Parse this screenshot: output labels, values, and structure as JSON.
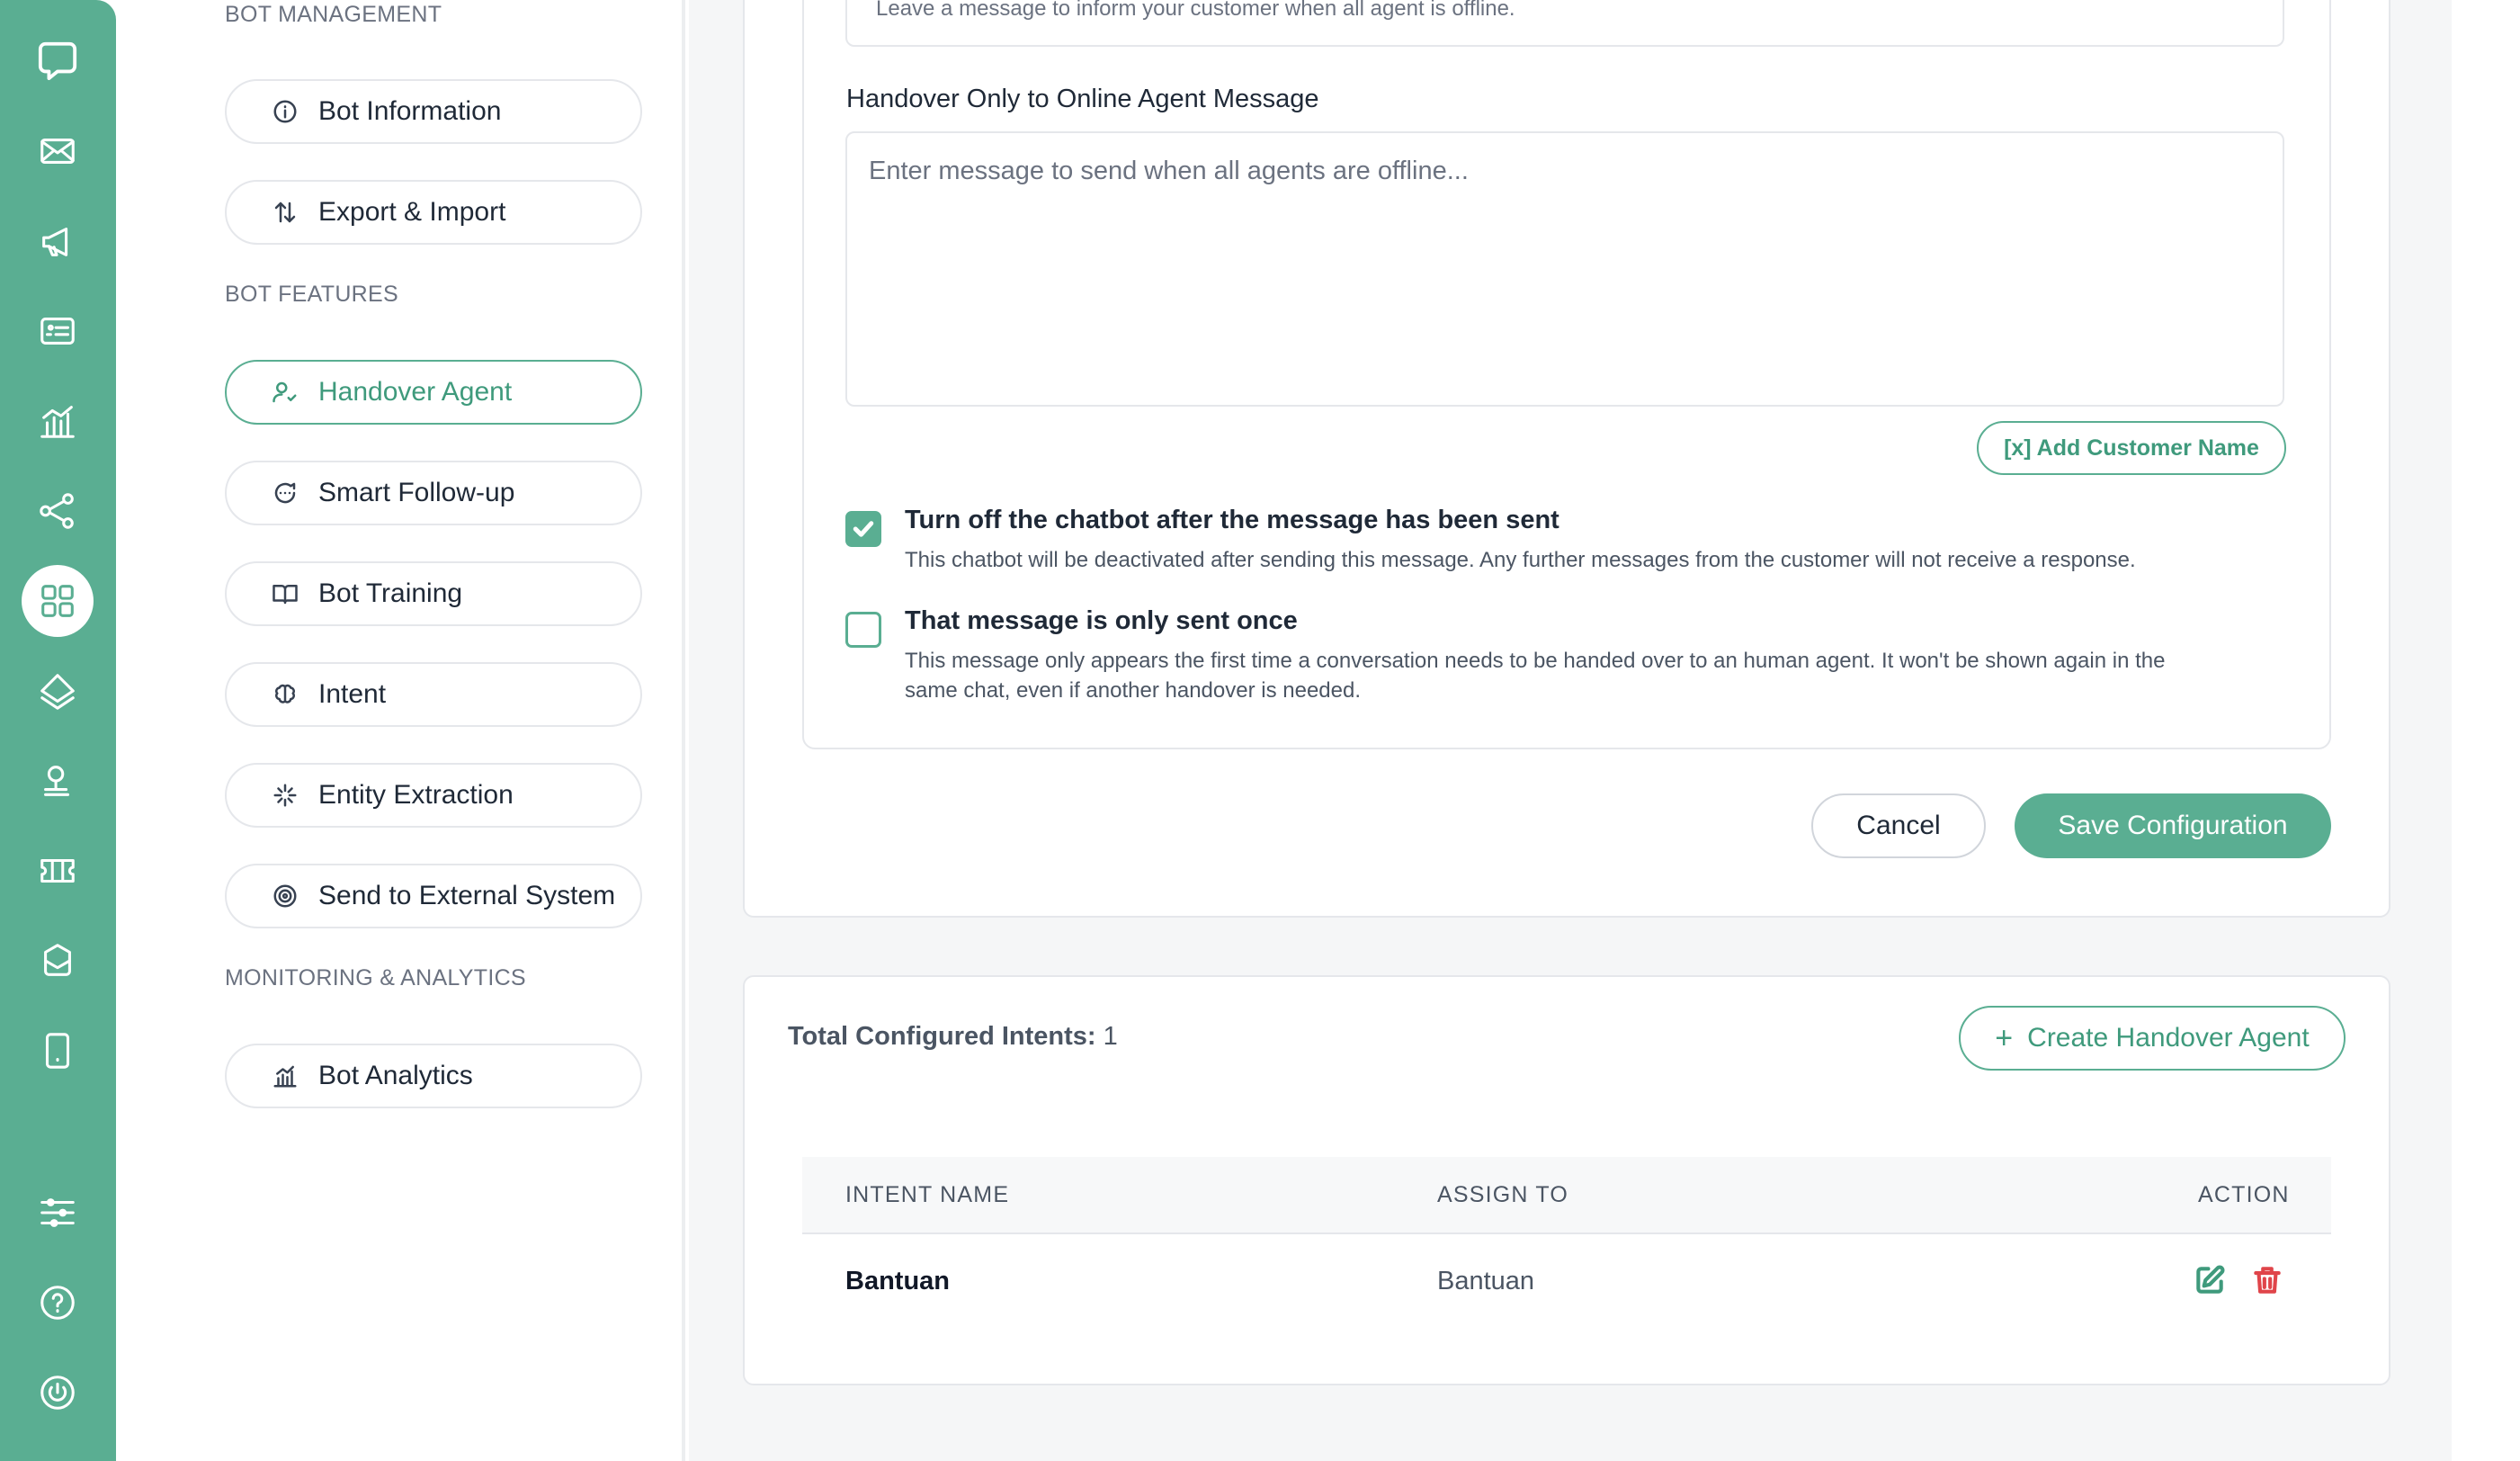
{
  "sidebar": {
    "sections": {
      "bot_management": "BOT MANAGEMENT",
      "bot_features": "BOT FEATURES",
      "monitoring": "MONITORING & ANALYTICS"
    },
    "items": [
      {
        "label": "Bot Information",
        "icon": "info-icon"
      },
      {
        "label": "Export & Import",
        "icon": "arrows-up-down-icon"
      },
      {
        "label": "Handover Agent",
        "icon": "user-check-icon",
        "active": true
      },
      {
        "label": "Smart Follow-up",
        "icon": "chat-bubble-icon"
      },
      {
        "label": "Bot Training",
        "icon": "book-open-icon"
      },
      {
        "label": "Intent",
        "icon": "brain-icon"
      },
      {
        "label": "Entity Extraction",
        "icon": "sparkle-icon"
      },
      {
        "label": "Send to External System",
        "icon": "target-icon"
      },
      {
        "label": "Bot Analytics",
        "icon": "bar-chart-icon"
      }
    ]
  },
  "form": {
    "offline_placeholder": "Leave a message to inform your customer when all agent is offline.",
    "handover_label": "Handover Only to Online Agent Message",
    "handover_placeholder": "Enter message to send when all agents are offline...",
    "add_customer_name": "[x] Add Customer Name",
    "options": [
      {
        "title": "Turn off the chatbot after the message has been sent",
        "desc": "This chatbot will be deactivated after sending this message. Any further messages from the customer will not receive a response.",
        "checked": true
      },
      {
        "title": "That message is only sent once",
        "desc_line1": "This message only appears the first time a conversation needs to be handed over to an human agent. It won't be shown again in the",
        "desc_line2": "same chat, even if another handover is needed.",
        "checked": false
      }
    ],
    "cancel": "Cancel",
    "save": "Save Configuration"
  },
  "intents": {
    "total_label": "Total Configured Intents:",
    "total_value": "1",
    "create_button": "Create Handover Agent",
    "columns": [
      "INTENT NAME",
      "ASSIGN TO",
      "ACTION"
    ],
    "rows": [
      {
        "intent_name": "Bantuan",
        "assign_to": "Bantuan"
      }
    ]
  },
  "colors": {
    "accent": "#5aae92",
    "accent_text": "#3f9a7c",
    "danger": "#e0454a",
    "rail": "#5aae92"
  }
}
